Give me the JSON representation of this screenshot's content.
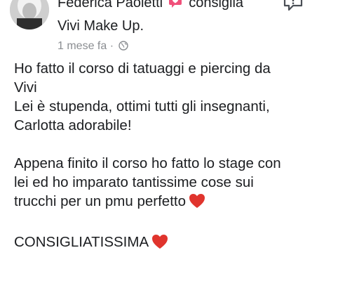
{
  "post": {
    "author": "Federica Paoletti",
    "action": "consiglia",
    "page_name": "Vivi Make Up.",
    "time": "1 mese fa",
    "separator": "·",
    "icons": {
      "avatar": "profile-avatar",
      "recommend": "recommend-speech-bubble-icon",
      "privacy": "globe-icon",
      "report": "report-flag-icon",
      "heart": "red-heart-emoji"
    },
    "colors": {
      "heart": "#e0342d",
      "recommend": "#f0507a",
      "meta": "#8a8d91"
    },
    "body": {
      "p1_line1": "Ho fatto il corso di tatuaggi e piercing da",
      "p1_line2": "Vivi",
      "p1_line3": "Lei è stupenda, ottimi tutti gli insegnanti,",
      "p1_line4": "Carlotta adorabile!",
      "p2_line1": "Appena finito il corso ho fatto lo stage con",
      "p2_line2": "lei ed ho imparato tantissime cose sui",
      "p2_line3": "trucchi per un  pmu perfetto",
      "p3_line1": "CONSIGLIATISSIMA"
    }
  }
}
